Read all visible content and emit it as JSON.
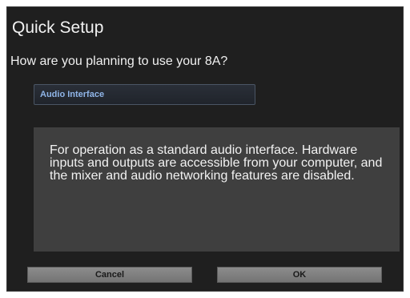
{
  "dialog": {
    "title": "Quick Setup",
    "question": "How are you planning to use your 8A?",
    "mode_select": {
      "selected": "Audio Interface"
    },
    "description": "For operation as a standard audio interface. Hardware inputs and outputs are accessible from your computer, and the mixer and audio networking features are disabled.",
    "buttons": {
      "cancel_label": "Cancel",
      "ok_label": "OK"
    }
  },
  "colors": {
    "dialog_background": "#1f1f1f",
    "panel_background": "#3f3f3f",
    "select_text": "#8fb5e8",
    "button_background": "#808080"
  }
}
